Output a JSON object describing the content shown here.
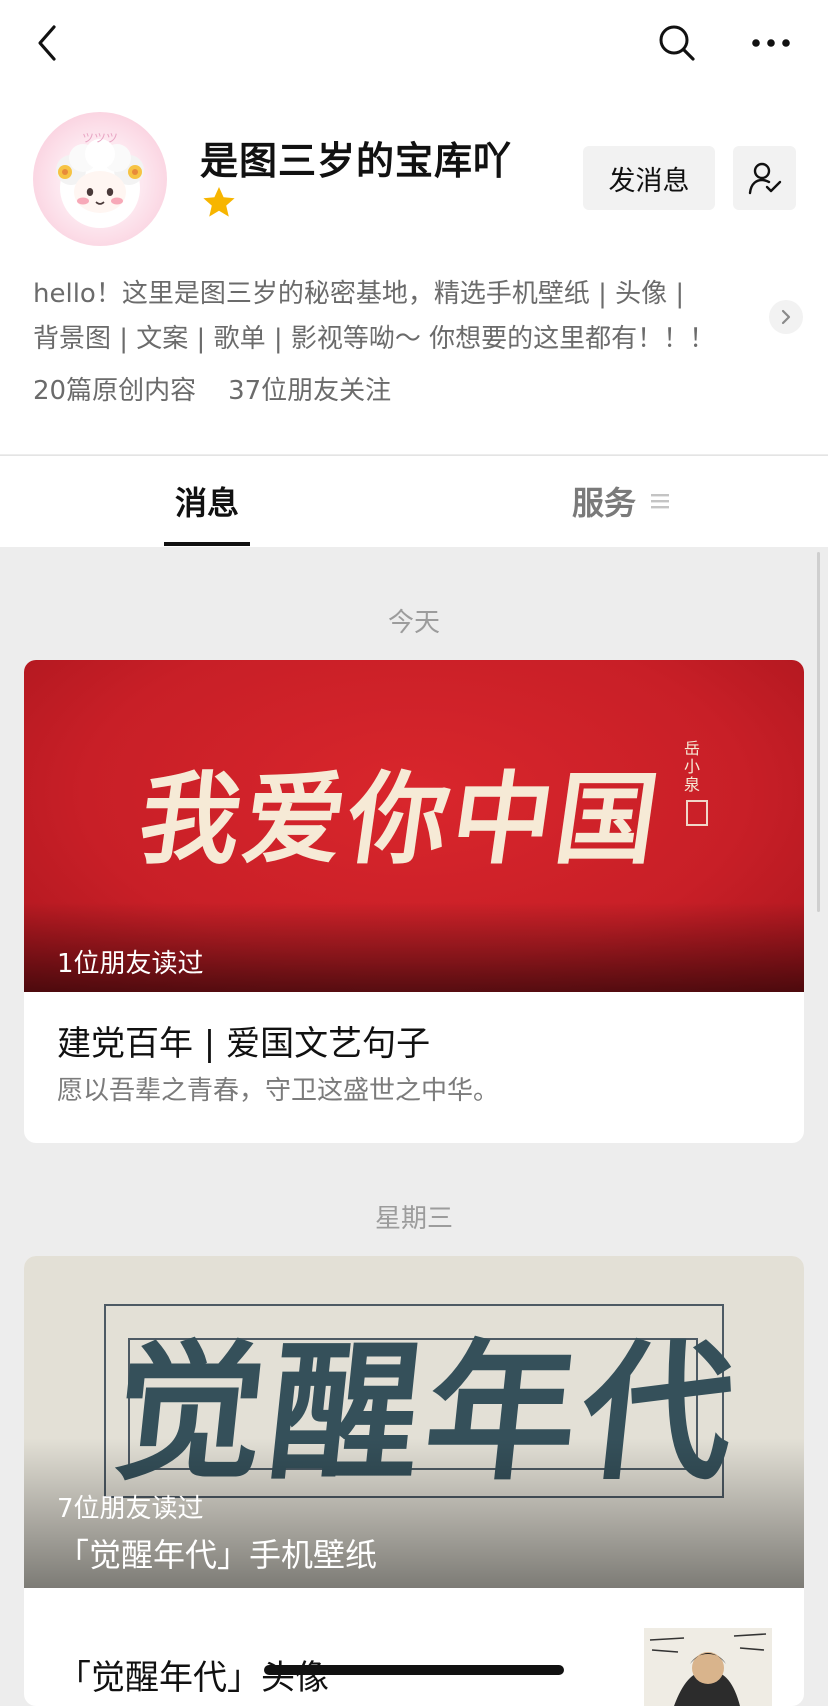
{
  "icons": {
    "back": "chevron-left-icon",
    "search": "search-icon",
    "more": "more-dots-icon",
    "star": "star-icon",
    "follow": "followed-user-icon",
    "bio_arrow": "chevron-right-icon",
    "service_menu": "menu-lines-icon"
  },
  "colors": {
    "accent_red": "#d42a2f",
    "star_yellow": "#f7b500",
    "page_bg": "#ededed"
  },
  "profile": {
    "name": "是图三岁的宝库吖",
    "message_button": "发消息",
    "bio_line1": "hello！这里是图三岁的秘密基地，精选手机壁纸 | 头像 |",
    "bio_line2": "背景图 | 文案 | 歌单 | 影视等呦～ 你想要的这里都有！！！",
    "original_count": "20篇原创内容",
    "friend_followers": "37位朋友关注"
  },
  "tabs": [
    {
      "label": "消息",
      "active": true
    },
    {
      "label": "服务",
      "active": false
    }
  ],
  "feed": [
    {
      "date": "今天",
      "cover_text": "我爱你中国",
      "cover_signature": "岳小泉",
      "readers": "1位朋友读过",
      "title": "建党百年 | 爱国文艺句子",
      "digest": "愿以吾辈之青春，守卫这盛世之中华。"
    },
    {
      "date": "星期三",
      "cover_text": "觉醒年代",
      "readers": "7位朋友读过",
      "cover_title": "「觉醒年代」手机壁纸",
      "sub_title": "「觉醒年代」头像"
    }
  ]
}
